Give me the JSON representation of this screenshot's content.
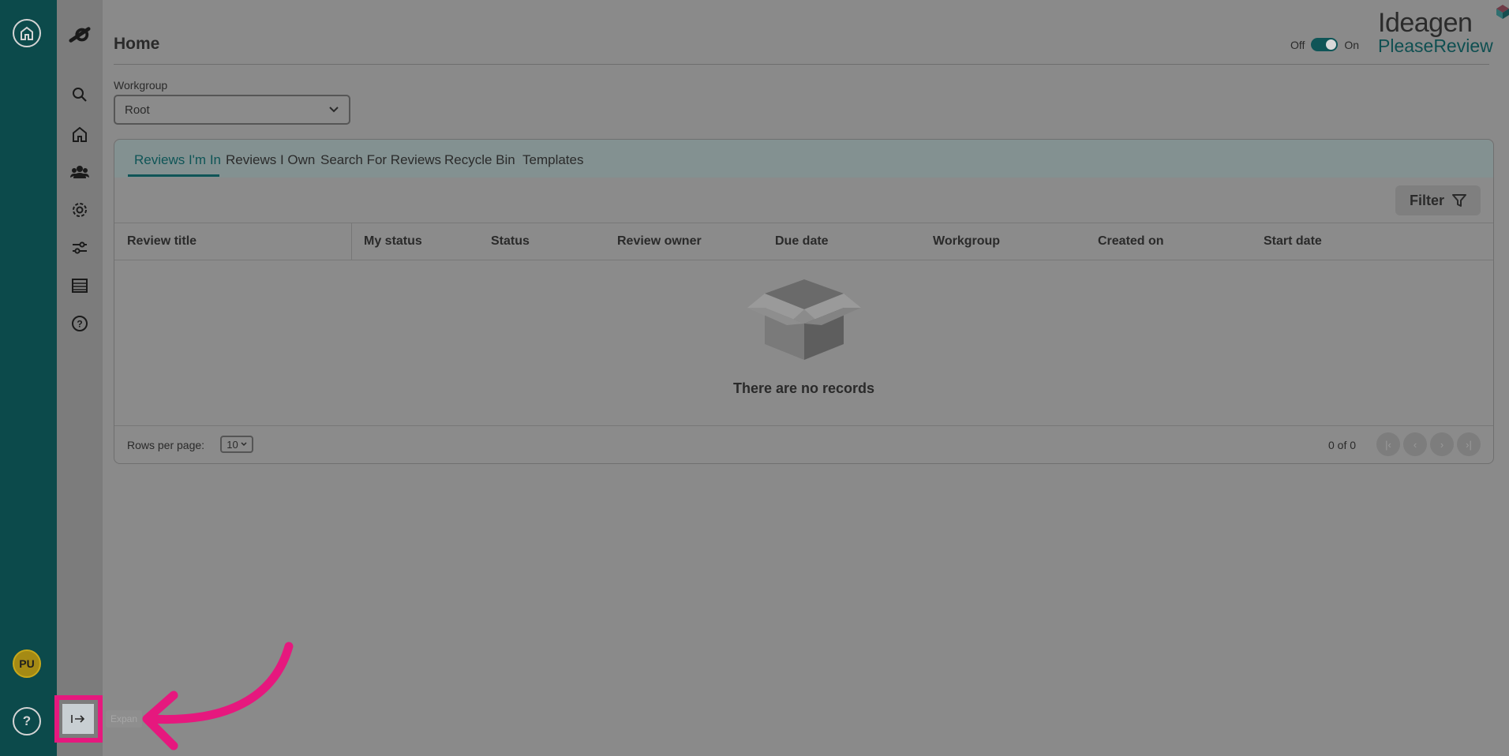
{
  "page": {
    "title": "Home",
    "toggle_off": "Off",
    "toggle_on": "On",
    "brand_top": "Ideagen",
    "brand_bottom": "PleaseReview"
  },
  "rail": {
    "home_icon": "home-icon",
    "help_label": "?",
    "avatar_initials": "PU"
  },
  "sidebar": {
    "items": [
      {
        "icon": "logo-icon"
      },
      {
        "icon": "search-icon"
      },
      {
        "icon": "home-icon"
      },
      {
        "icon": "users-icon"
      },
      {
        "icon": "gear-icon"
      },
      {
        "icon": "sliders-icon"
      },
      {
        "icon": "list-icon"
      },
      {
        "icon": "help-icon"
      }
    ],
    "expand_icon": "expand-icon",
    "expand_tooltip": "Expan"
  },
  "workgroup": {
    "label": "Workgroup",
    "value": "Root"
  },
  "tabs": [
    {
      "label": "Reviews I'm In",
      "active": true
    },
    {
      "label": "Reviews I Own"
    },
    {
      "label": "Search For Reviews"
    },
    {
      "label": "Recycle Bin"
    },
    {
      "label": "Templates"
    }
  ],
  "filter": {
    "label": "Filter"
  },
  "table": {
    "columns": [
      "Review title",
      "My status",
      "Status",
      "Review owner",
      "Due date",
      "Workgroup",
      "Created on",
      "Start date"
    ],
    "empty_message": "There are no records"
  },
  "pagination": {
    "rows_label": "Rows per page:",
    "rows_value": "10",
    "count": "0 of 0"
  },
  "colors": {
    "rail": "#0c4a4b",
    "accent": "#0f5557",
    "highlight": "#e6187e",
    "avatar": "#a58a14"
  }
}
